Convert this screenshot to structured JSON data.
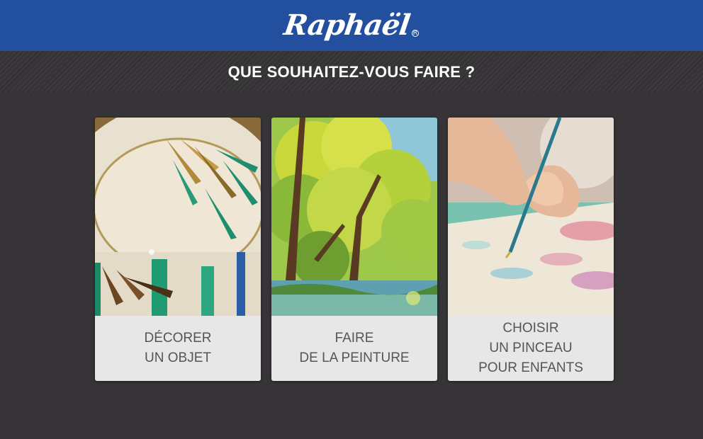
{
  "header": {
    "logo": "Raphaël",
    "registered": "R"
  },
  "page": {
    "title": "QUE SOUHAITEZ-VOUS FAIRE ?"
  },
  "cards": [
    {
      "lines": [
        "DÉCORER",
        "UN OBJET"
      ],
      "image": "decorated-bowl-image"
    },
    {
      "lines": [
        "FAIRE",
        "DE LA PEINTURE"
      ],
      "image": "landscape-painting-image"
    },
    {
      "lines": [
        "CHOISIR",
        "UN PINCEAU",
        "POUR ENFANTS"
      ],
      "image": "child-painting-image"
    }
  ],
  "colors": {
    "header_bg": "#22509e",
    "page_bg": "#363436",
    "label_bg": "#f5f5f5",
    "label_text": "#555555"
  }
}
